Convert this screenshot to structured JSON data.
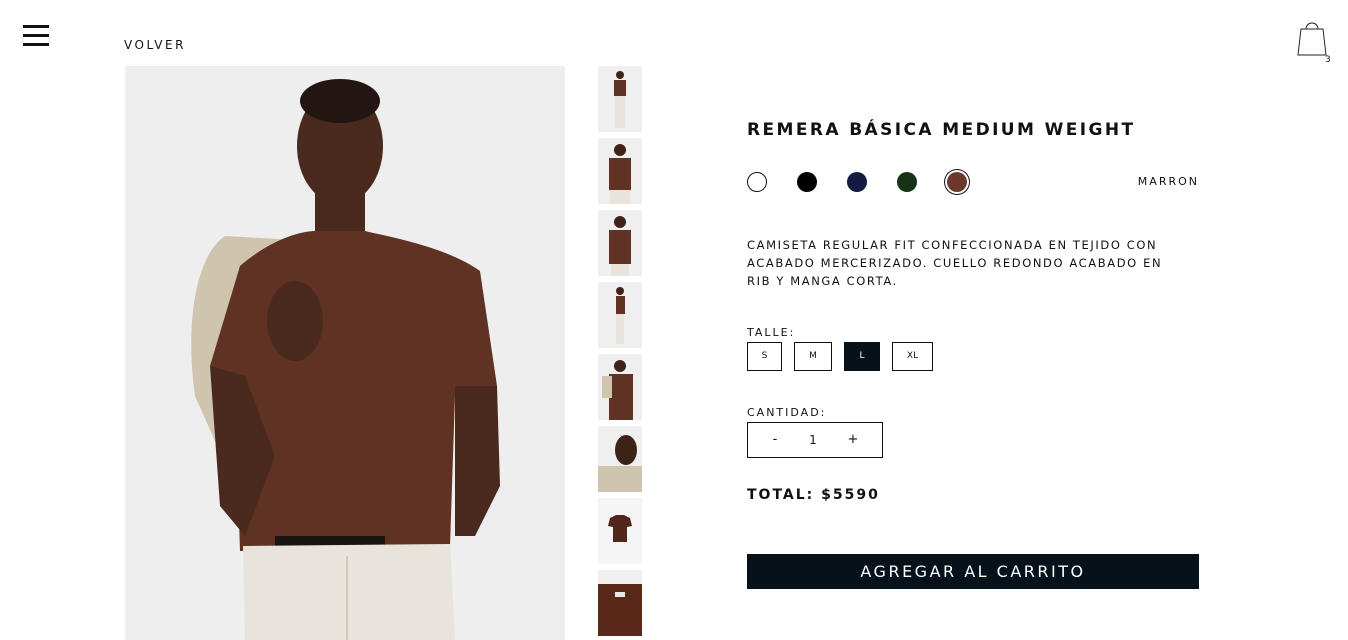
{
  "header": {
    "back_label": "VOLVER",
    "cart_count": "3"
  },
  "product": {
    "title": "REMERA BÁSICA MEDIUM WEIGHT",
    "description": "CAMISETA REGULAR FIT CONFECCIONADA EN TEJIDO CON ACABADO MERCERIZADO. CUELLO REDONDO ACABADO EN RIB Y MANGA CORTA.",
    "selected_color_name": "MARRON",
    "colors": [
      {
        "hex": "#ffffff"
      },
      {
        "hex": "#000000"
      },
      {
        "hex": "#141a40"
      },
      {
        "hex": "#173217"
      },
      {
        "hex": "#6b3a2d",
        "selected": true
      }
    ],
    "size_label": "TALLE:",
    "sizes": [
      "S",
      "M",
      "L",
      "XL"
    ],
    "selected_size": "L",
    "quantity_label": "CANTIDAD:",
    "quantity": "1",
    "qty_minus": "-",
    "qty_plus": "+",
    "total_label": "TOTAL: $5590",
    "add_to_cart_label": "AGREGAR AL CARRITO"
  },
  "theme": {
    "accent": "#071119",
    "shirt": "#5f3223",
    "pants": "#e8e4dc"
  },
  "icons": [
    "hamburger-menu-icon",
    "shopping-bag-icon"
  ]
}
